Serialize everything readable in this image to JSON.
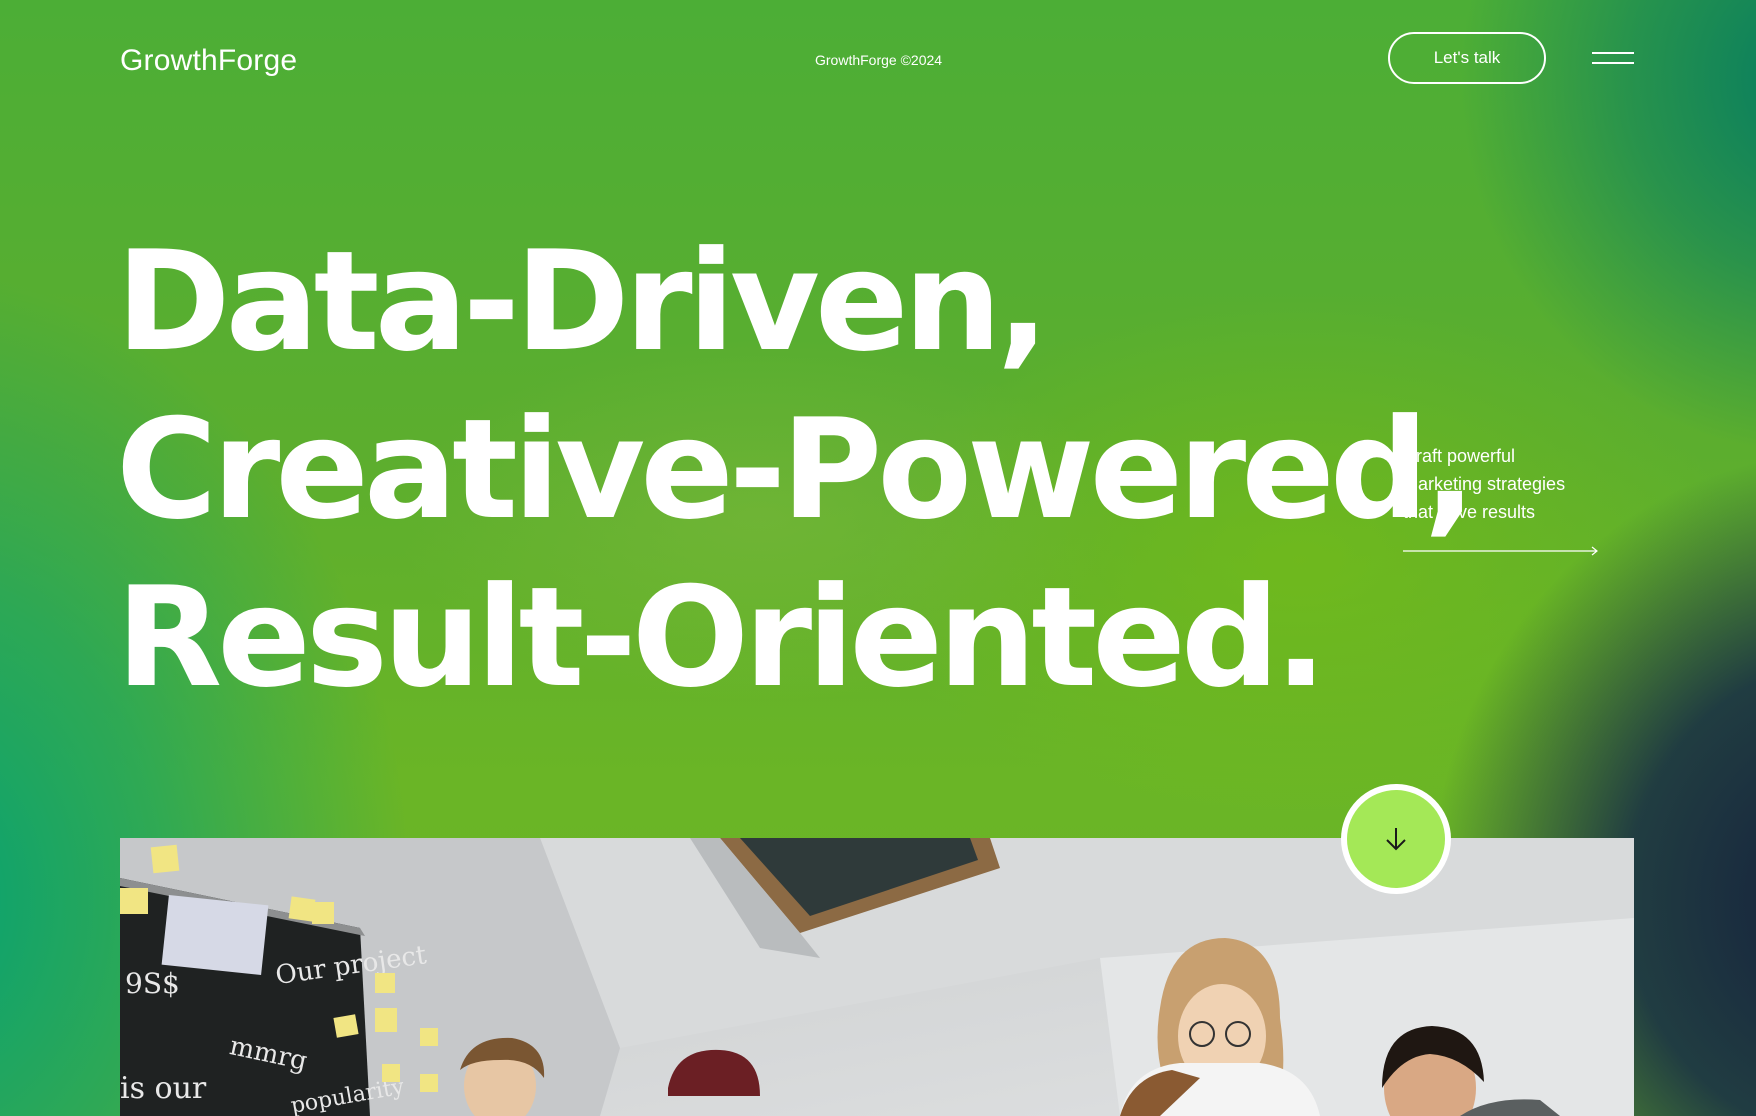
{
  "header": {
    "logo": "GrowthForge",
    "copyright": "GrowthForge ©2024",
    "cta_label": "Let's talk",
    "menu_icon": "hamburger-icon"
  },
  "hero": {
    "headline_lines": [
      "Data-Driven,",
      "Creative-Powered,",
      "Result-Oriented."
    ],
    "tagline_lines": [
      "Craft powerful",
      "marketing strategies",
      "that drive results"
    ],
    "tagline_arrow_icon": "arrow-right-icon",
    "scroll_icon": "arrow-down-icon"
  },
  "image": {
    "description_icon": "team-photo"
  },
  "colors": {
    "accent": "#a4e857",
    "text": "#ffffff",
    "green": "#5cae2e",
    "teal": "#00a078",
    "navy": "#14203c"
  }
}
